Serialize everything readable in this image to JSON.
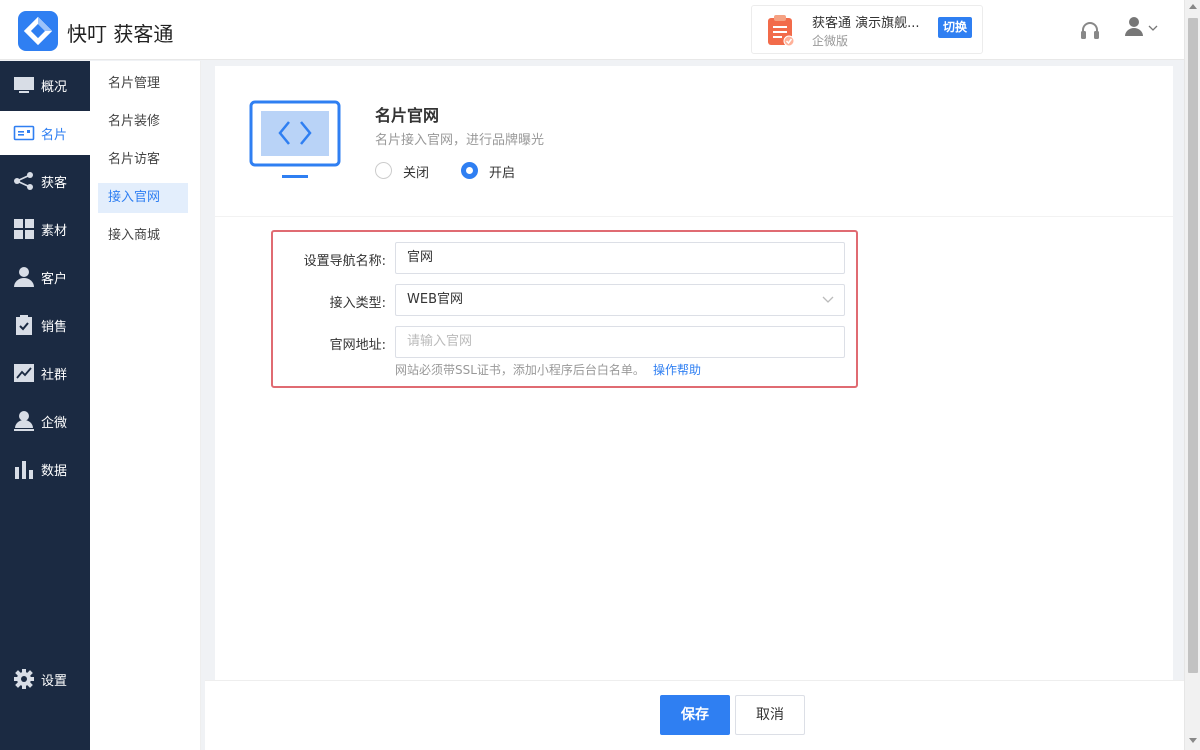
{
  "app": {
    "title": "快叮 获客通",
    "logo_icon": "app-logo-icon"
  },
  "header": {
    "account_name": "获客通 演示旗舰...",
    "account_edition": "企微版",
    "switch_label": "切换",
    "support_icon": "headset-icon",
    "user_icon": "user-icon"
  },
  "sidebar": {
    "items": [
      {
        "label": "概况",
        "icon": "monitor-icon"
      },
      {
        "label": "名片",
        "icon": "card-icon"
      },
      {
        "label": "获客",
        "icon": "share-icon"
      },
      {
        "label": "素材",
        "icon": "grid-icon"
      },
      {
        "label": "客户",
        "icon": "person-icon"
      },
      {
        "label": "销售",
        "icon": "clipboard-check-icon"
      },
      {
        "label": "社群",
        "icon": "trend-icon"
      },
      {
        "label": "企微",
        "icon": "user-badge-icon"
      },
      {
        "label": "数据",
        "icon": "bar-chart-icon"
      }
    ],
    "settings_label": "设置",
    "active_index": 1
  },
  "subnav": {
    "items": [
      "名片管理",
      "名片装修",
      "名片访客",
      "接入官网",
      "接入商城"
    ],
    "active_index": 3
  },
  "feature": {
    "title": "名片官网",
    "desc": "名片接入官网，进行品牌曝光",
    "radio_off": "关闭",
    "radio_on": "开启",
    "selected": "开启"
  },
  "form": {
    "nav_name_label": "设置导航名称:",
    "nav_name_value": "官网",
    "type_label": "接入类型:",
    "type_value": "WEB官网",
    "url_label": "官网地址:",
    "url_placeholder": "请输入官网",
    "hint": "网站必须带SSL证书，添加小程序后台白名单。",
    "help_link": "操作帮助"
  },
  "footer": {
    "save_label": "保存",
    "cancel_label": "取消"
  },
  "colors": {
    "accent": "#2f7ff2",
    "sidebar_bg": "#1b2a42",
    "highlight_border": "#e06b72"
  }
}
